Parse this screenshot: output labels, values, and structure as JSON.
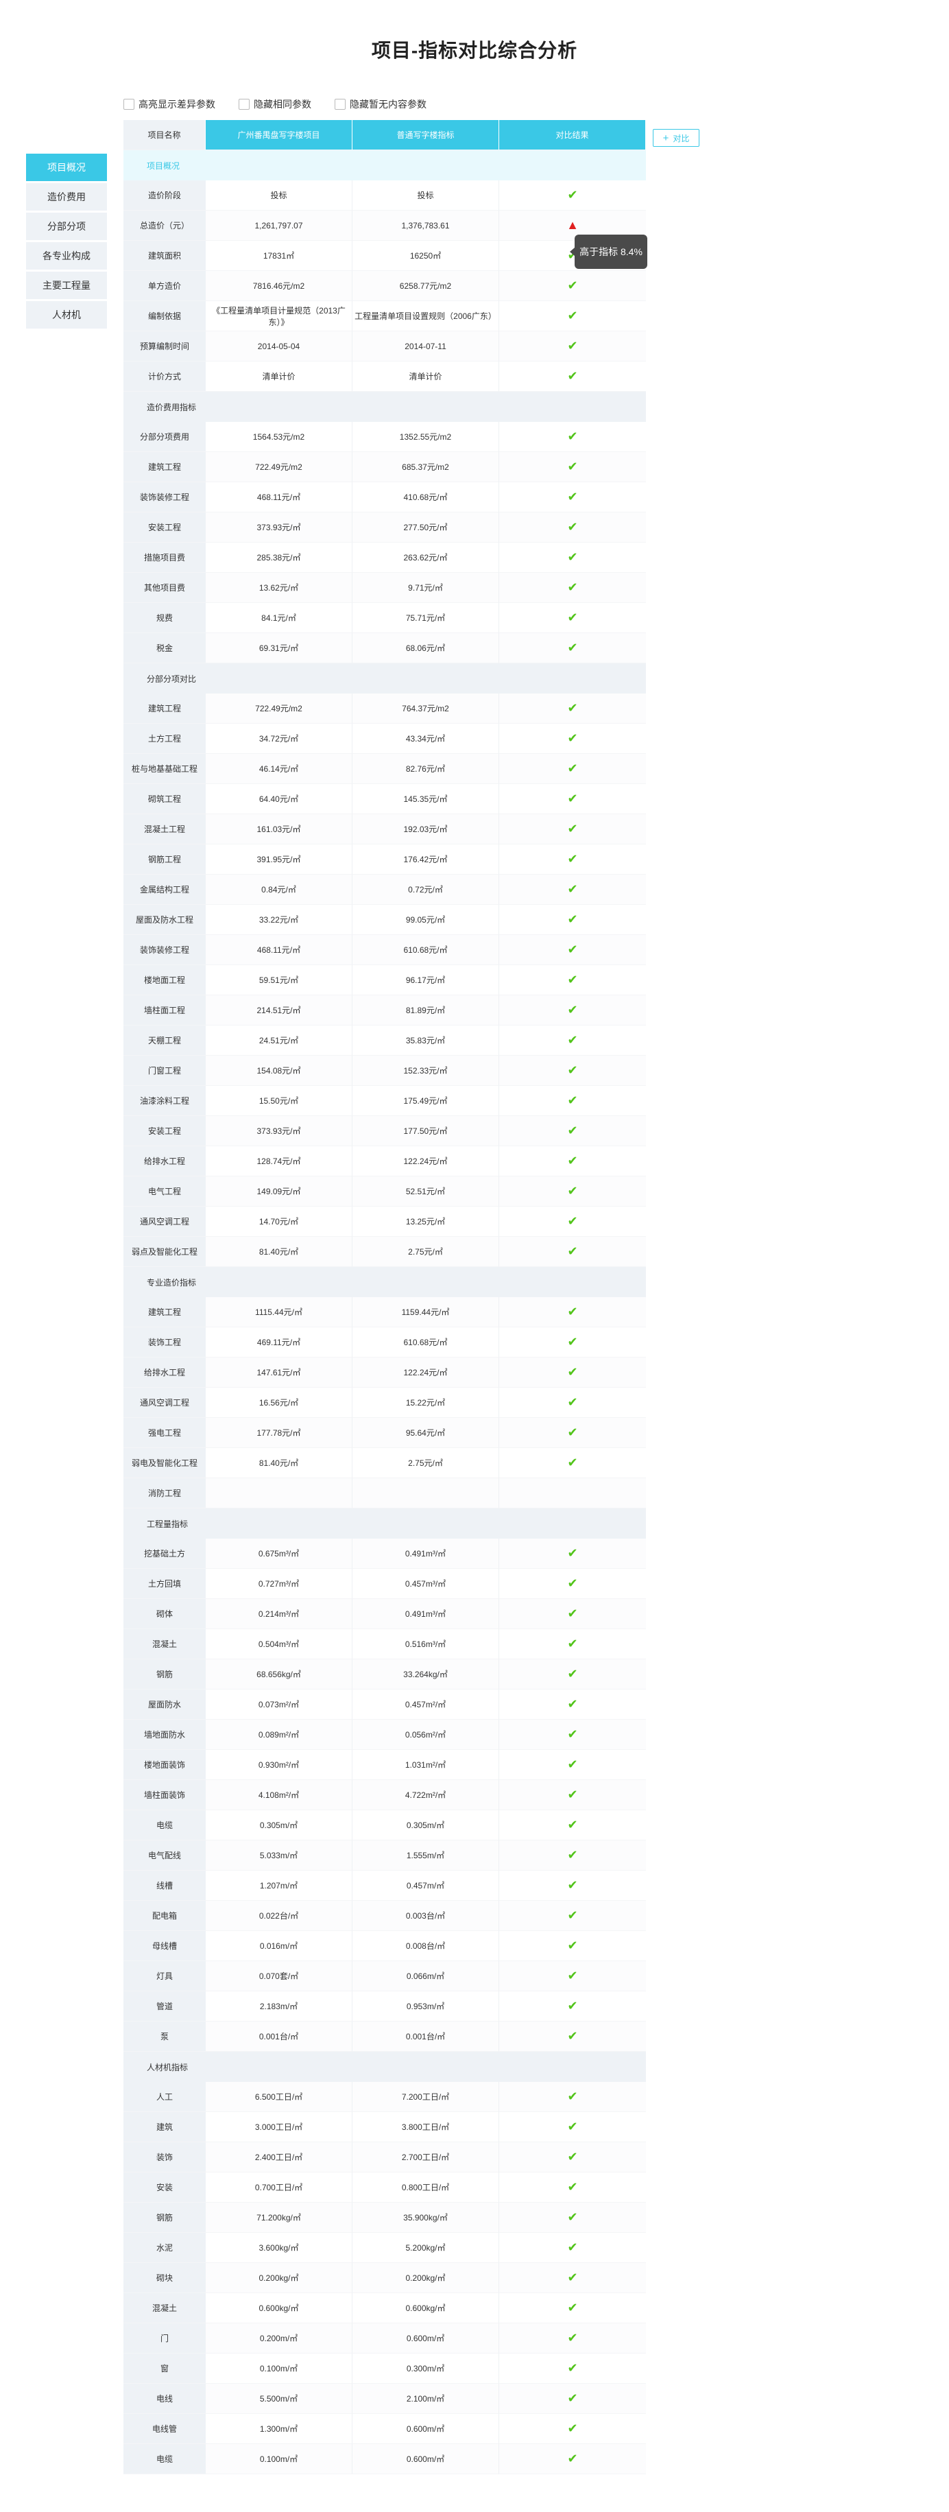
{
  "page_title": "项目-指标对比综合分析",
  "options": [
    {
      "label": "高亮显示差异参数"
    },
    {
      "label": "隐藏相同参数"
    },
    {
      "label": "隐藏暂无内容参数"
    }
  ],
  "sidebar": {
    "items": [
      {
        "label": "项目概况",
        "active": true
      },
      {
        "label": "造价费用",
        "active": false
      },
      {
        "label": "分部分项",
        "active": false
      },
      {
        "label": "各专业构成",
        "active": false
      },
      {
        "label": "主要工程量",
        "active": false
      },
      {
        "label": "人材机",
        "active": false
      }
    ]
  },
  "compare_button": {
    "icon": "+",
    "label": "对比"
  },
  "tooltip": {
    "text": "高于指标 8.4%"
  },
  "colors": {
    "accent": "#3ac8e6",
    "check": "#52c41a",
    "warn": "#e02020"
  },
  "table": {
    "header": [
      "项目名称",
      "广州番禺盘写字楼项目",
      "普通写字楼指标",
      "对比结果"
    ],
    "sections": [
      {
        "title": "项目概况",
        "rows": [
          {
            "label": "造价阶段",
            "v1": "投标",
            "v2": "投标",
            "result": "ok"
          },
          {
            "label": "总造价（元）",
            "v1": "1,261,797.07",
            "v2": "1,376,783.61",
            "result": "warn"
          },
          {
            "label": "建筑面积",
            "v1": "17831㎡",
            "v2": "16250㎡",
            "result": "ok"
          },
          {
            "label": "单方造价",
            "v1": "7816.46元/m2",
            "v2": "6258.77元/m2",
            "result": "ok"
          },
          {
            "label": "编制依据",
            "v1": "《工程量清单项目计量规范（2013广东）》",
            "v2": "工程量清单项目设置规则（2006广东）",
            "result": "ok"
          },
          {
            "label": "预算编制时间",
            "v1": "2014-05-04",
            "v2": "2014-07-11",
            "result": "ok"
          },
          {
            "label": "计价方式",
            "v1": "清单计价",
            "v2": "清单计价",
            "result": "ok"
          }
        ]
      },
      {
        "title": "造价费用指标",
        "rows": [
          {
            "label": "分部分项费用",
            "v1": "1564.53元/m2",
            "v2": "1352.55元/m2",
            "result": "ok"
          },
          {
            "label": "建筑工程",
            "v1": "722.49元/m2",
            "v2": "685.37元/m2",
            "result": "ok"
          },
          {
            "label": "装饰装修工程",
            "v1": "468.11元/㎡",
            "v2": "410.68元/㎡",
            "result": "ok"
          },
          {
            "label": "安装工程",
            "v1": "373.93元/㎡",
            "v2": "277.50元/㎡",
            "result": "ok"
          },
          {
            "label": "措施项目费",
            "v1": "285.38元/㎡",
            "v2": "263.62元/㎡",
            "result": "ok"
          },
          {
            "label": "其他项目费",
            "v1": "13.62元/㎡",
            "v2": "9.71元/㎡",
            "result": "ok"
          },
          {
            "label": "规费",
            "v1": "84.1元/㎡",
            "v2": "75.71元/㎡",
            "result": "ok"
          },
          {
            "label": "税金",
            "v1": "69.31元/㎡",
            "v2": "68.06元/㎡",
            "result": "ok"
          }
        ]
      },
      {
        "title": "分部分项对比",
        "rows": [
          {
            "label": "建筑工程",
            "v1": "722.49元/m2",
            "v2": "764.37元/m2",
            "result": "ok"
          },
          {
            "label": "土方工程",
            "v1": "34.72元/㎡",
            "v2": "43.34元/㎡",
            "result": "ok"
          },
          {
            "label": "桩与地基基础工程",
            "v1": "46.14元/㎡",
            "v2": "82.76元/㎡",
            "result": "ok"
          },
          {
            "label": "砌筑工程",
            "v1": "64.40元/㎡",
            "v2": "145.35元/㎡",
            "result": "ok"
          },
          {
            "label": "混凝土工程",
            "v1": "161.03元/㎡",
            "v2": "192.03元/㎡",
            "result": "ok"
          },
          {
            "label": "钢筋工程",
            "v1": "391.95元/㎡",
            "v2": "176.42元/㎡",
            "result": "ok"
          },
          {
            "label": "金属结构工程",
            "v1": "0.84元/㎡",
            "v2": "0.72元/㎡",
            "result": "ok"
          },
          {
            "label": "屋面及防水工程",
            "v1": "33.22元/㎡",
            "v2": "99.05元/㎡",
            "result": "ok"
          },
          {
            "label": "装饰装修工程",
            "v1": "468.11元/㎡",
            "v2": "610.68元/㎡",
            "result": "ok"
          },
          {
            "label": "楼地面工程",
            "v1": "59.51元/㎡",
            "v2": "96.17元/㎡",
            "result": "ok"
          },
          {
            "label": "墙柱面工程",
            "v1": "214.51元/㎡",
            "v2": "81.89元/㎡",
            "result": "ok"
          },
          {
            "label": "天棚工程",
            "v1": "24.51元/㎡",
            "v2": "35.83元/㎡",
            "result": "ok"
          },
          {
            "label": "门窗工程",
            "v1": "154.08元/㎡",
            "v2": "152.33元/㎡",
            "result": "ok"
          },
          {
            "label": "油漆涂料工程",
            "v1": "15.50元/㎡",
            "v2": "175.49元/㎡",
            "result": "ok"
          },
          {
            "label": "安装工程",
            "v1": "373.93元/㎡",
            "v2": "177.50元/㎡",
            "result": "ok"
          },
          {
            "label": "给排水工程",
            "v1": "128.74元/㎡",
            "v2": "122.24元/㎡",
            "result": "ok"
          },
          {
            "label": "电气工程",
            "v1": "149.09元/㎡",
            "v2": "52.51元/㎡",
            "result": "ok"
          },
          {
            "label": "通风空调工程",
            "v1": "14.70元/㎡",
            "v2": "13.25元/㎡",
            "result": "ok"
          },
          {
            "label": "弱点及智能化工程",
            "v1": "81.40元/㎡",
            "v2": "2.75元/㎡",
            "result": "ok"
          }
        ]
      },
      {
        "title": "专业造价指标",
        "rows": [
          {
            "label": "建筑工程",
            "v1": "1115.44元/㎡",
            "v2": "1159.44元/㎡",
            "result": "ok"
          },
          {
            "label": "装饰工程",
            "v1": "469.11元/㎡",
            "v2": "610.68元/㎡",
            "result": "ok"
          },
          {
            "label": "给排水工程",
            "v1": "147.61元/㎡",
            "v2": "122.24元/㎡",
            "result": "ok"
          },
          {
            "label": "通风空调工程",
            "v1": "16.56元/㎡",
            "v2": "15.22元/㎡",
            "result": "ok"
          },
          {
            "label": "强电工程",
            "v1": "177.78元/㎡",
            "v2": "95.64元/㎡",
            "result": "ok"
          },
          {
            "label": "弱电及智能化工程",
            "v1": "81.40元/㎡",
            "v2": "2.75元/㎡",
            "result": "ok"
          },
          {
            "label": "消防工程",
            "v1": "",
            "v2": "",
            "result": "none"
          }
        ]
      },
      {
        "title": "工程量指标",
        "rows": [
          {
            "label": "挖基础土方",
            "v1": "0.675m³/㎡",
            "v2": "0.491m³/㎡",
            "result": "ok"
          },
          {
            "label": "土方回填",
            "v1": "0.727m³/㎡",
            "v2": "0.457m³/㎡",
            "result": "ok"
          },
          {
            "label": "砌体",
            "v1": "0.214m³/㎡",
            "v2": "0.491m³/㎡",
            "result": "ok"
          },
          {
            "label": "混凝土",
            "v1": "0.504m³/㎡",
            "v2": "0.516m³/㎡",
            "result": "ok"
          },
          {
            "label": "钢筋",
            "v1": "68.656kg/㎡",
            "v2": "33.264kg/㎡",
            "result": "ok"
          },
          {
            "label": "屋面防水",
            "v1": "0.073m²/㎡",
            "v2": "0.457m²/㎡",
            "result": "ok"
          },
          {
            "label": "墙地面防水",
            "v1": "0.089m²/㎡",
            "v2": "0.056m²/㎡",
            "result": "ok"
          },
          {
            "label": "楼地面装饰",
            "v1": "0.930m²/㎡",
            "v2": "1.031m²/㎡",
            "result": "ok"
          },
          {
            "label": "墙柱面装饰",
            "v1": "4.108m²/㎡",
            "v2": "4.722m²/㎡",
            "result": "ok"
          },
          {
            "label": "电缆",
            "v1": "0.305m/㎡",
            "v2": "0.305m/㎡",
            "result": "ok"
          },
          {
            "label": "电气配线",
            "v1": "5.033m/㎡",
            "v2": "1.555m/㎡",
            "result": "ok"
          },
          {
            "label": "线槽",
            "v1": "1.207m/㎡",
            "v2": "0.457m/㎡",
            "result": "ok"
          },
          {
            "label": "配电箱",
            "v1": "0.022台/㎡",
            "v2": "0.003台/㎡",
            "result": "ok"
          },
          {
            "label": "母线槽",
            "v1": "0.016m/㎡",
            "v2": "0.008台/㎡",
            "result": "ok"
          },
          {
            "label": "灯具",
            "v1": "0.070套/㎡",
            "v2": "0.066m/㎡",
            "result": "ok"
          },
          {
            "label": "管道",
            "v1": "2.183m/㎡",
            "v2": "0.953m/㎡",
            "result": "ok"
          },
          {
            "label": "泵",
            "v1": "0.001台/㎡",
            "v2": "0.001台/㎡",
            "result": "ok"
          }
        ]
      },
      {
        "title": "人材机指标",
        "rows": [
          {
            "label": "人工",
            "v1": "6.500工日/㎡",
            "v2": "7.200工日/㎡",
            "result": "ok"
          },
          {
            "label": "建筑",
            "v1": "3.000工日/㎡",
            "v2": "3.800工日/㎡",
            "result": "ok"
          },
          {
            "label": "装饰",
            "v1": "2.400工日/㎡",
            "v2": "2.700工日/㎡",
            "result": "ok"
          },
          {
            "label": "安装",
            "v1": "0.700工日/㎡",
            "v2": "0.800工日/㎡",
            "result": "ok"
          },
          {
            "label": "钢筋",
            "v1": "71.200kg/㎡",
            "v2": "35.900kg/㎡",
            "result": "ok"
          },
          {
            "label": "水泥",
            "v1": "3.600kg/㎡",
            "v2": "5.200kg/㎡",
            "result": "ok"
          },
          {
            "label": "砌块",
            "v1": "0.200kg/㎡",
            "v2": "0.200kg/㎡",
            "result": "ok"
          },
          {
            "label": "混凝土",
            "v1": "0.600kg/㎡",
            "v2": "0.600kg/㎡",
            "result": "ok"
          },
          {
            "label": "门",
            "v1": "0.200m/㎡",
            "v2": "0.600m/㎡",
            "result": "ok"
          },
          {
            "label": "窗",
            "v1": "0.100m/㎡",
            "v2": "0.300m/㎡",
            "result": "ok"
          },
          {
            "label": "电线",
            "v1": "5.500m/㎡",
            "v2": "2.100m/㎡",
            "result": "ok"
          },
          {
            "label": "电线管",
            "v1": "1.300m/㎡",
            "v2": "0.600m/㎡",
            "result": "ok"
          },
          {
            "label": "电缆",
            "v1": "0.100m/㎡",
            "v2": "0.600m/㎡",
            "result": "ok"
          }
        ]
      }
    ]
  }
}
